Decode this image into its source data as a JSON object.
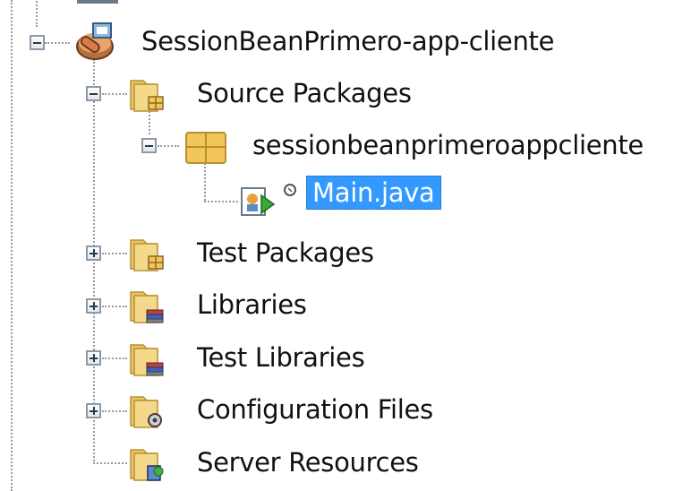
{
  "tree": {
    "project": {
      "label": "SessionBeanPrimero-app-cliente",
      "icon": "project-icon",
      "expanded": true
    },
    "nodes": [
      {
        "label": "Source Packages",
        "icon": "source-packages-folder-icon",
        "expanded": true
      },
      {
        "label": "sessionbeanprimeroappcliente",
        "icon": "package-icon",
        "expanded": true
      },
      {
        "label": "Main.java",
        "icon": "java-main-class-icon",
        "selected": true
      },
      {
        "label": "Test Packages",
        "icon": "test-packages-folder-icon",
        "expanded": false
      },
      {
        "label": "Libraries",
        "icon": "libraries-folder-icon",
        "expanded": false
      },
      {
        "label": "Test Libraries",
        "icon": "test-libraries-folder-icon",
        "expanded": false
      },
      {
        "label": "Configuration Files",
        "icon": "configuration-files-folder-icon",
        "expanded": false
      },
      {
        "label": "Server Resources",
        "icon": "server-resources-folder-icon"
      }
    ]
  },
  "colors": {
    "selection": "#3399ff",
    "folder": "#f5d98b",
    "tree_lines": "#9a9a9a"
  }
}
